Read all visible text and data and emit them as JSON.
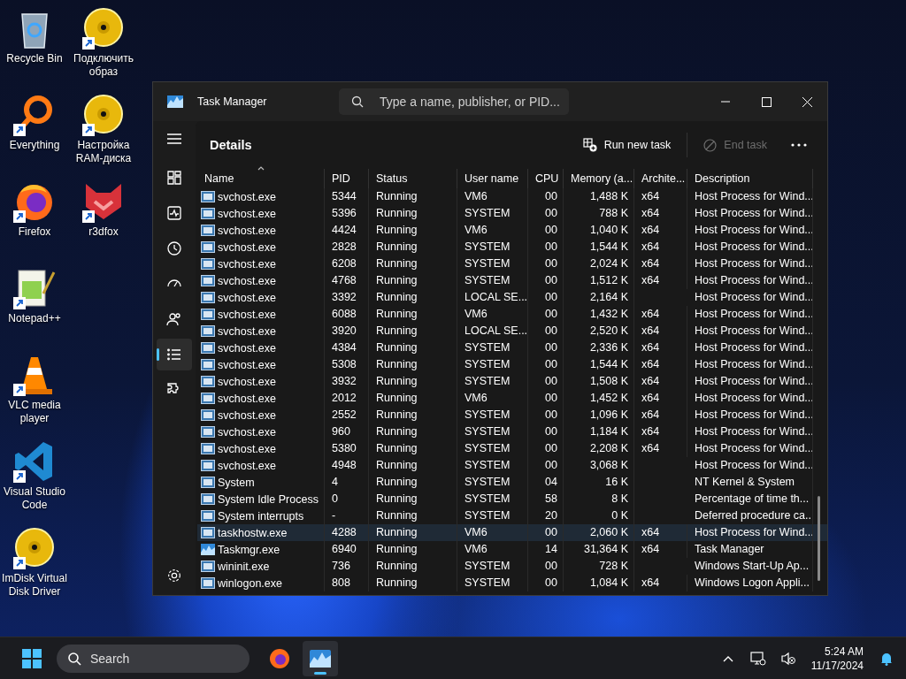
{
  "desktop_icons": [
    {
      "label": "Recycle Bin",
      "kind": "bin",
      "shortcut": false
    },
    {
      "label": "Подключить образ",
      "kind": "disc",
      "shortcut": true
    },
    {
      "label": "Everything",
      "kind": "magnifier",
      "shortcut": true
    },
    {
      "label": "Настройка RAM-диска",
      "kind": "disc",
      "shortcut": true
    },
    {
      "label": "Firefox",
      "kind": "firefox",
      "shortcut": true
    },
    {
      "label": "r3dfox",
      "kind": "redfox",
      "shortcut": true
    },
    {
      "label": "Notepad++",
      "kind": "notepad",
      "shortcut": true
    },
    {
      "label": "VLC media player",
      "kind": "cone",
      "shortcut": true
    },
    {
      "label": "Visual Studio Code",
      "kind": "vscode",
      "shortcut": true
    },
    {
      "label": "ImDisk Virtual Disk Driver",
      "kind": "disc",
      "shortcut": true
    }
  ],
  "window": {
    "title": "Task Manager",
    "search": {
      "placeholder": "Type a name, publisher, or PID..."
    }
  },
  "sidebar": {
    "items": [
      {
        "kind": "processes",
        "selected": false
      },
      {
        "kind": "performance",
        "selected": false
      },
      {
        "kind": "history",
        "selected": false
      },
      {
        "kind": "startup",
        "selected": false
      },
      {
        "kind": "users",
        "selected": false
      },
      {
        "kind": "details",
        "selected": true
      },
      {
        "kind": "services",
        "selected": false
      }
    ]
  },
  "page": {
    "title": "Details",
    "actions": [
      {
        "label": "Run new task",
        "kind": "run",
        "disabled": false
      },
      {
        "label": "End task",
        "kind": "end",
        "disabled": true
      }
    ]
  },
  "table": {
    "columns": [
      "Name",
      "PID",
      "Status",
      "User name",
      "CPU",
      "Memory (a...",
      "Archite...",
      "Description"
    ],
    "rows": [
      {
        "kind": "service",
        "cells": [
          "svchost.exe",
          "5344",
          "Running",
          "VM6",
          "00",
          "1,488 K",
          "x64",
          "Host Process for Wind..."
        ],
        "selected": false
      },
      {
        "kind": "service",
        "cells": [
          "svchost.exe",
          "5396",
          "Running",
          "SYSTEM",
          "00",
          "788 K",
          "x64",
          "Host Process for Wind..."
        ],
        "selected": false
      },
      {
        "kind": "service",
        "cells": [
          "svchost.exe",
          "4424",
          "Running",
          "VM6",
          "00",
          "1,040 K",
          "x64",
          "Host Process for Wind..."
        ],
        "selected": false
      },
      {
        "kind": "service",
        "cells": [
          "svchost.exe",
          "2828",
          "Running",
          "SYSTEM",
          "00",
          "1,544 K",
          "x64",
          "Host Process for Wind..."
        ],
        "selected": false
      },
      {
        "kind": "service",
        "cells": [
          "svchost.exe",
          "6208",
          "Running",
          "SYSTEM",
          "00",
          "2,024 K",
          "x64",
          "Host Process for Wind..."
        ],
        "selected": false
      },
      {
        "kind": "service",
        "cells": [
          "svchost.exe",
          "4768",
          "Running",
          "SYSTEM",
          "00",
          "1,512 K",
          "x64",
          "Host Process for Wind..."
        ],
        "selected": false
      },
      {
        "kind": "service",
        "cells": [
          "svchost.exe",
          "3392",
          "Running",
          "LOCAL SE...",
          "00",
          "2,164 K",
          "",
          "Host Process for Wind..."
        ],
        "selected": false
      },
      {
        "kind": "service",
        "cells": [
          "svchost.exe",
          "6088",
          "Running",
          "VM6",
          "00",
          "1,432 K",
          "x64",
          "Host Process for Wind..."
        ],
        "selected": false
      },
      {
        "kind": "service",
        "cells": [
          "svchost.exe",
          "3920",
          "Running",
          "LOCAL SE...",
          "00",
          "2,520 K",
          "x64",
          "Host Process for Wind..."
        ],
        "selected": false
      },
      {
        "kind": "service",
        "cells": [
          "svchost.exe",
          "4384",
          "Running",
          "SYSTEM",
          "00",
          "2,336 K",
          "x64",
          "Host Process for Wind..."
        ],
        "selected": false
      },
      {
        "kind": "service",
        "cells": [
          "svchost.exe",
          "5308",
          "Running",
          "SYSTEM",
          "00",
          "1,544 K",
          "x64",
          "Host Process for Wind..."
        ],
        "selected": false
      },
      {
        "kind": "service",
        "cells": [
          "svchost.exe",
          "3932",
          "Running",
          "SYSTEM",
          "00",
          "1,508 K",
          "x64",
          "Host Process for Wind..."
        ],
        "selected": false
      },
      {
        "kind": "service",
        "cells": [
          "svchost.exe",
          "2012",
          "Running",
          "VM6",
          "00",
          "1,452 K",
          "x64",
          "Host Process for Wind..."
        ],
        "selected": false
      },
      {
        "kind": "service",
        "cells": [
          "svchost.exe",
          "2552",
          "Running",
          "SYSTEM",
          "00",
          "1,096 K",
          "x64",
          "Host Process for Wind..."
        ],
        "selected": false
      },
      {
        "kind": "service",
        "cells": [
          "svchost.exe",
          "960",
          "Running",
          "SYSTEM",
          "00",
          "1,184 K",
          "x64",
          "Host Process for Wind..."
        ],
        "selected": false
      },
      {
        "kind": "service",
        "cells": [
          "svchost.exe",
          "5380",
          "Running",
          "SYSTEM",
          "00",
          "2,208 K",
          "x64",
          "Host Process for Wind..."
        ],
        "selected": false
      },
      {
        "kind": "service",
        "cells": [
          "svchost.exe",
          "4948",
          "Running",
          "SYSTEM",
          "00",
          "3,068 K",
          "",
          "Host Process for Wind..."
        ],
        "selected": false
      },
      {
        "kind": "service",
        "cells": [
          "System",
          "4",
          "Running",
          "SYSTEM",
          "04",
          "16 K",
          "",
          "NT Kernel & System"
        ],
        "selected": false
      },
      {
        "kind": "service",
        "cells": [
          "System Idle Process",
          "0",
          "Running",
          "SYSTEM",
          "58",
          "8 K",
          "",
          "Percentage of time th..."
        ],
        "selected": false
      },
      {
        "kind": "service",
        "cells": [
          "System interrupts",
          "-",
          "Running",
          "SYSTEM",
          "20",
          "0 K",
          "",
          "Deferred procedure ca..."
        ],
        "selected": false
      },
      {
        "kind": "service",
        "cells": [
          "taskhostw.exe",
          "4288",
          "Running",
          "VM6",
          "00",
          "2,060 K",
          "x64",
          "Host Process for Wind..."
        ],
        "selected": true
      },
      {
        "kind": "taskmgr",
        "cells": [
          "Taskmgr.exe",
          "6940",
          "Running",
          "VM6",
          "14",
          "31,364 K",
          "x64",
          "Task Manager"
        ],
        "selected": false
      },
      {
        "kind": "service",
        "cells": [
          "wininit.exe",
          "736",
          "Running",
          "SYSTEM",
          "00",
          "728 K",
          "",
          "Windows Start-Up Ap..."
        ],
        "selected": false
      },
      {
        "kind": "service",
        "cells": [
          "winlogon.exe",
          "808",
          "Running",
          "SYSTEM",
          "00",
          "1,084 K",
          "x64",
          "Windows Logon Appli..."
        ],
        "selected": false
      }
    ]
  },
  "taskbar": {
    "search": {
      "placeholder": "Search"
    },
    "apps": [
      {
        "kind": "firefox",
        "active": false
      },
      {
        "kind": "taskmgr",
        "active": true
      }
    ],
    "time": "5:24 AM",
    "date": "11/17/2024"
  }
}
